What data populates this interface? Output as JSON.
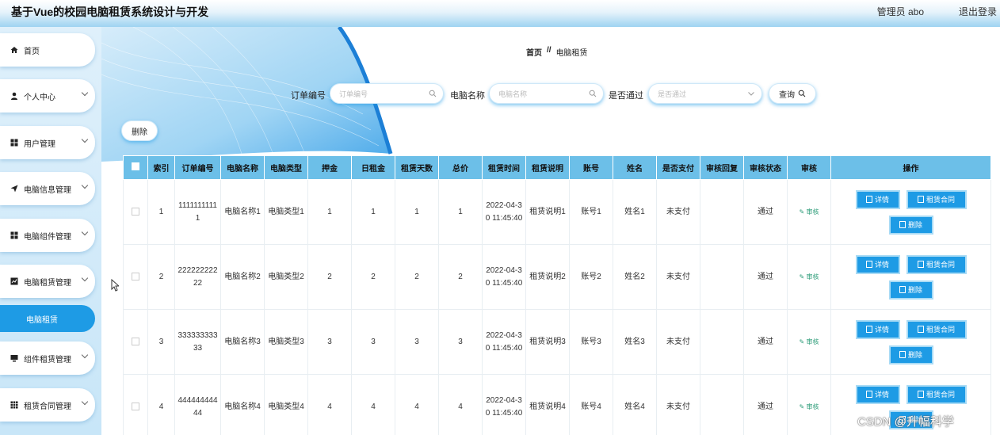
{
  "header": {
    "title": "基于Vue的校园电脑租赁系统设计与开发",
    "admin_label": "管理员 abo",
    "logout_label": "退出登录"
  },
  "sidebar": {
    "items": [
      {
        "label": "首页",
        "icon": "home-icon"
      },
      {
        "label": "个人中心",
        "icon": "user-icon"
      },
      {
        "label": "用户管理",
        "icon": "grid-icon"
      },
      {
        "label": "电脑信息管理",
        "icon": "send-icon"
      },
      {
        "label": "电脑组件管理",
        "icon": "grid-icon"
      },
      {
        "label": "电脑租赁管理",
        "icon": "chart-icon"
      },
      {
        "label": "组件租赁管理",
        "icon": "monitor-icon"
      },
      {
        "label": "租赁合同管理",
        "icon": "apps-icon"
      }
    ],
    "active_sub": "电脑租赁"
  },
  "breadcrumb": {
    "home": "首页",
    "separator": "//",
    "current": "电脑租赁"
  },
  "search": {
    "order_label": "订单编号",
    "order_placeholder": "订单编号",
    "name_label": "电脑名称",
    "name_placeholder": "电脑名称",
    "pass_label": "是否通过",
    "pass_placeholder": "是否通过",
    "query_label": "查询"
  },
  "toolbar": {
    "delete_label": "删除"
  },
  "table": {
    "columns": [
      "索引",
      "订单编号",
      "电脑名称",
      "电脑类型",
      "押金",
      "日租金",
      "租赁天数",
      "总价",
      "租赁时间",
      "租赁说明",
      "账号",
      "姓名",
      "是否支付",
      "审核回复",
      "审核状态",
      "审核",
      "操作"
    ],
    "rows": [
      {
        "index": "1",
        "order_no": "11111111111",
        "pc_name": "电脑名称1",
        "pc_type": "电脑类型1",
        "deposit": "1",
        "daily_rent": "1",
        "days": "1",
        "total": "1",
        "rent_time": "2022-04-30 11:45:40",
        "rent_desc": "租赁说明1",
        "account": "账号1",
        "name": "姓名1",
        "paid": "未支付",
        "reply": "",
        "status": "通过",
        "audit": "审核"
      },
      {
        "index": "2",
        "order_no": "22222222222",
        "pc_name": "电脑名称2",
        "pc_type": "电脑类型2",
        "deposit": "2",
        "daily_rent": "2",
        "days": "2",
        "total": "2",
        "rent_time": "2022-04-30 11:45:40",
        "rent_desc": "租赁说明2",
        "account": "账号2",
        "name": "姓名2",
        "paid": "未支付",
        "reply": "",
        "status": "通过",
        "audit": "审核"
      },
      {
        "index": "3",
        "order_no": "33333333333",
        "pc_name": "电脑名称3",
        "pc_type": "电脑类型3",
        "deposit": "3",
        "daily_rent": "3",
        "days": "3",
        "total": "3",
        "rent_time": "2022-04-30 11:45:40",
        "rent_desc": "租赁说明3",
        "account": "账号3",
        "name": "姓名3",
        "paid": "未支付",
        "reply": "",
        "status": "通过",
        "audit": "审核"
      },
      {
        "index": "4",
        "order_no": "44444444444",
        "pc_name": "电脑名称4",
        "pc_type": "电脑类型4",
        "deposit": "4",
        "daily_rent": "4",
        "days": "4",
        "total": "4",
        "rent_time": "2022-04-30 11:45:40",
        "rent_desc": "租赁说明4",
        "account": "账号4",
        "name": "姓名4",
        "paid": "未支付",
        "reply": "",
        "status": "通过",
        "audit": "审核"
      }
    ],
    "actions": {
      "detail": "详情",
      "contract": "租赁合同",
      "delete": "删除"
    }
  },
  "watermark": "CSDN @升幅科学",
  "colors": {
    "accent": "#1e9be5",
    "table_header": "#6cbfe8",
    "audit_link": "#2a9b77"
  }
}
